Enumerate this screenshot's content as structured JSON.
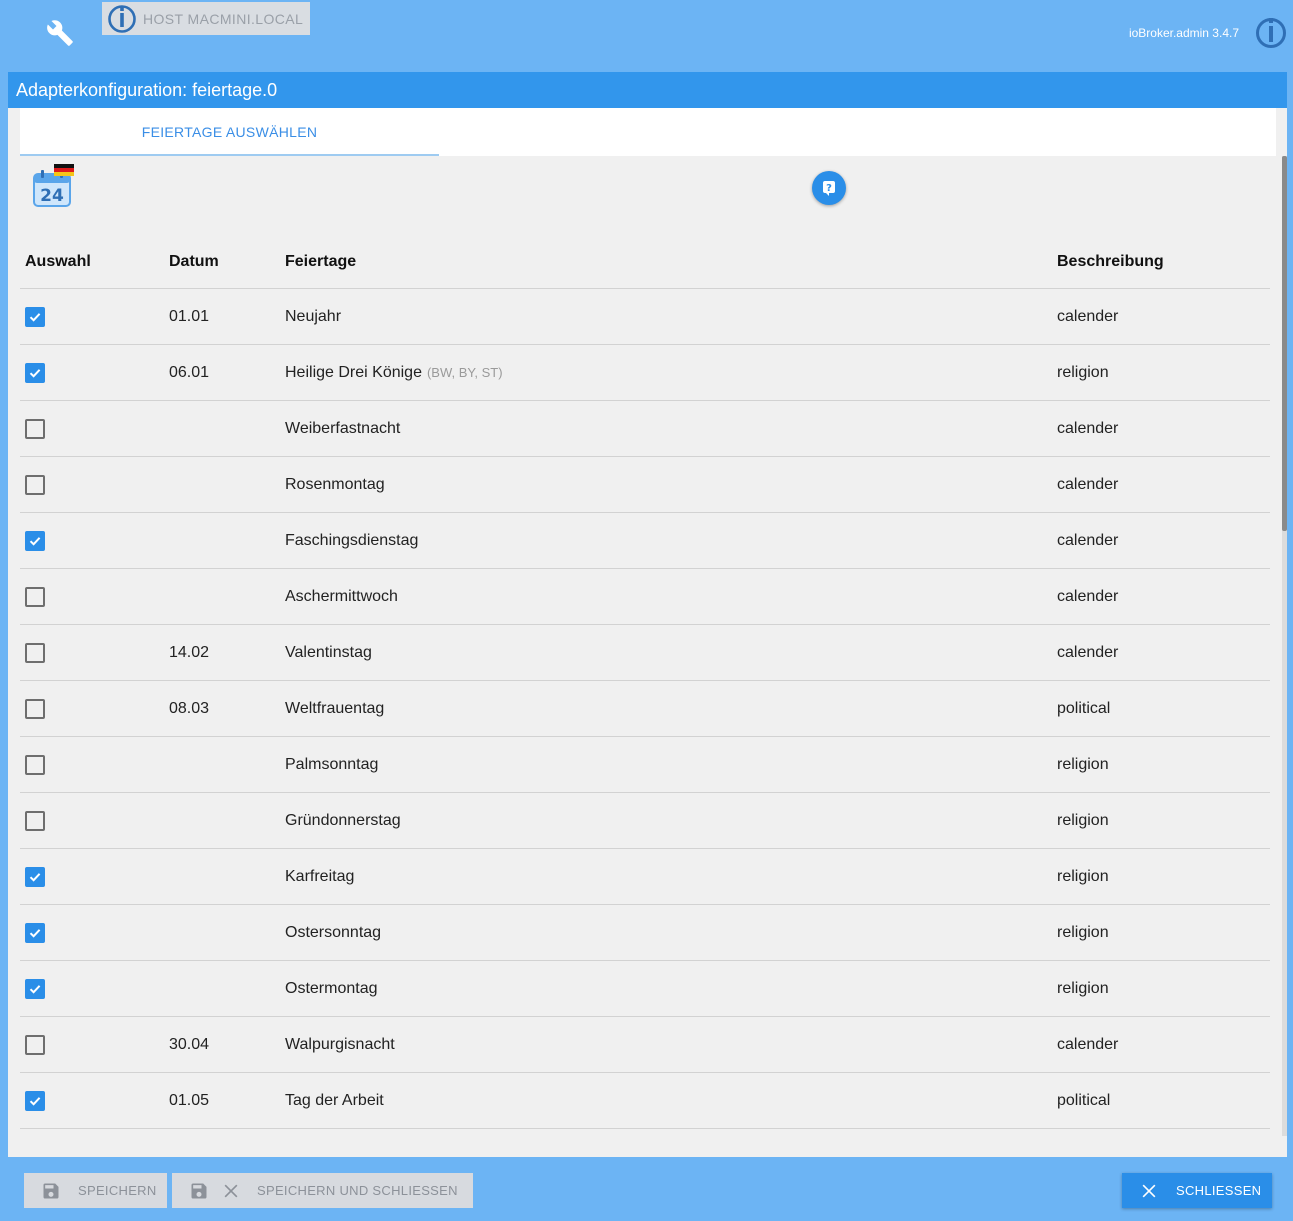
{
  "header": {
    "host_label": "HOST MACMINI.LOCAL",
    "version": "ioBroker.admin 3.4.7"
  },
  "dialog": {
    "title": "Adapterkonfiguration: feiertage.0",
    "tab_label": "FEIERTAGE AUSWÄHLEN"
  },
  "table": {
    "headers": {
      "select": "Auswahl",
      "date": "Datum",
      "name": "Feiertage",
      "description": "Beschreibung"
    },
    "rows": [
      {
        "checked": true,
        "date": "01.01",
        "name": "Neujahr",
        "region": "",
        "description": "calender"
      },
      {
        "checked": true,
        "date": "06.01",
        "name": "Heilige Drei Könige",
        "region": "(BW, BY, ST)",
        "description": "religion"
      },
      {
        "checked": false,
        "date": "",
        "name": "Weiberfastnacht",
        "region": "",
        "description": "calender"
      },
      {
        "checked": false,
        "date": "",
        "name": "Rosenmontag",
        "region": "",
        "description": "calender"
      },
      {
        "checked": true,
        "date": "",
        "name": "Faschingsdienstag",
        "region": "",
        "description": "calender"
      },
      {
        "checked": false,
        "date": "",
        "name": "Aschermittwoch",
        "region": "",
        "description": "calender"
      },
      {
        "checked": false,
        "date": "14.02",
        "name": "Valentinstag",
        "region": "",
        "description": "calender"
      },
      {
        "checked": false,
        "date": "08.03",
        "name": "Weltfrauentag",
        "region": "",
        "description": "political"
      },
      {
        "checked": false,
        "date": "",
        "name": "Palmsonntag",
        "region": "",
        "description": "religion"
      },
      {
        "checked": false,
        "date": "",
        "name": "Gründonnerstag",
        "region": "",
        "description": "religion"
      },
      {
        "checked": true,
        "date": "",
        "name": "Karfreitag",
        "region": "",
        "description": "religion"
      },
      {
        "checked": true,
        "date": "",
        "name": "Ostersonntag",
        "region": "",
        "description": "religion"
      },
      {
        "checked": true,
        "date": "",
        "name": "Ostermontag",
        "region": "",
        "description": "religion"
      },
      {
        "checked": false,
        "date": "30.04",
        "name": "Walpurgisnacht",
        "region": "",
        "description": "calender"
      },
      {
        "checked": true,
        "date": "01.05",
        "name": "Tag der Arbeit",
        "region": "",
        "description": "political"
      }
    ]
  },
  "footer": {
    "save_label": "SPEICHERN",
    "save_close_label": "SPEICHERN UND SCHLIESSEN",
    "close_label": "SCHLIESSEN"
  },
  "icons": {
    "settings": "wrench-icon",
    "logo": "iobroker-logo-icon",
    "calendar": "calendar-24-icon",
    "help": "help-icon",
    "save": "floppy-disk-icon",
    "close": "close-icon"
  },
  "colors": {
    "header_bg": "#6cb4f4",
    "title_bg": "#3296ec",
    "accent": "#2a8ee8",
    "content_bg": "#f0f0f0"
  }
}
